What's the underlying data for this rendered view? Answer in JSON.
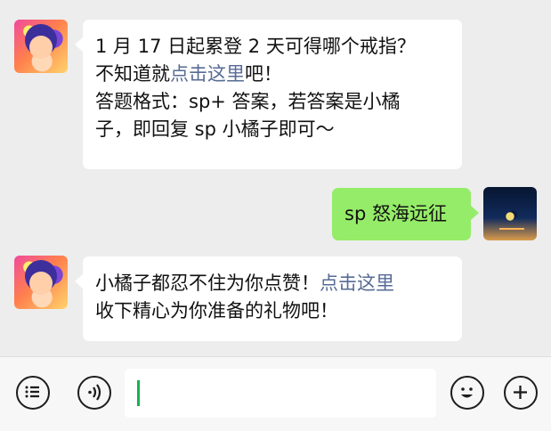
{
  "messages": [
    {
      "sender": "game-assistant",
      "avatar_icon": "game-character-avatar-icon",
      "line1": "1 月 17 日起累登 2 天可得哪个戒指？",
      "line2_prefix": "不知道就",
      "line2_link": "点击这里",
      "line2_suffix": "吧！",
      "line3": "答题格式：sp+ 答案，若答案是小橘",
      "line4": "子，即回复 sp 小橘子即可～"
    },
    {
      "sender": "user",
      "avatar_icon": "night-moon-avatar-icon",
      "text": "sp 怒海远征"
    },
    {
      "sender": "game-assistant",
      "avatar_icon": "game-character-avatar-icon",
      "line1_prefix": "小橘子都忍不住为你点赞！",
      "line1_link": "点击这里",
      "line2": "收下精心为你准备的礼物吧！"
    }
  ],
  "input_bar": {
    "left_icons": [
      "menu-icon",
      "voice-icon"
    ],
    "right_icons": [
      "emoji-icon",
      "plus-icon"
    ],
    "input_value": ""
  },
  "colors": {
    "background": "#ededed",
    "incoming_bubble": "#ffffff",
    "outgoing_bubble": "#95ec69",
    "link": "#576b95",
    "cursor": "#16b24f"
  }
}
